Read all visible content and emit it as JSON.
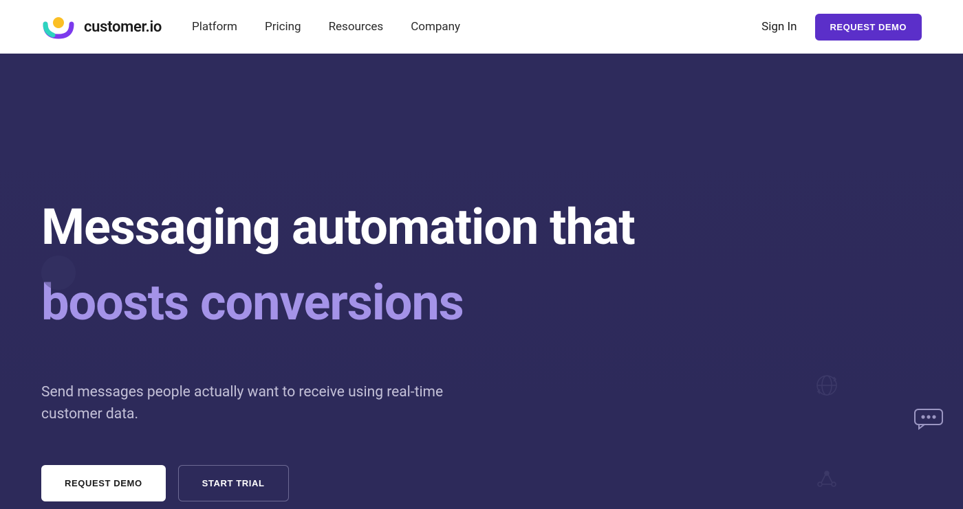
{
  "logo": {
    "text": "customer.io"
  },
  "nav": {
    "items": [
      "Platform",
      "Pricing",
      "Resources",
      "Company"
    ]
  },
  "header": {
    "sign_in": "Sign In",
    "request_demo": "REQUEST DEMO"
  },
  "hero": {
    "title_line1": "Messaging automation that",
    "title_line2": "boosts conversions",
    "subtitle": "Send messages people actually want to receive using real-time customer data.",
    "cta_primary": "REQUEST DEMO",
    "cta_secondary": "START TRIAL"
  }
}
